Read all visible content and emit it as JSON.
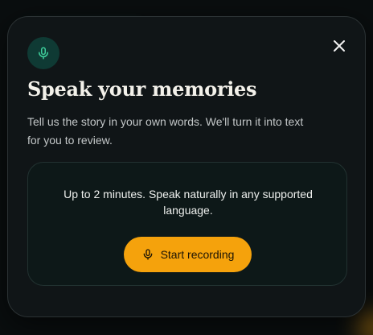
{
  "dialog": {
    "title": "Speak your memories",
    "subtitle": "Tell us the story in your own words. We'll turn it into text for you to review.",
    "hint": "Up to 2 minutes. Speak naturally in any supported language.",
    "record_button_label": "Start recording"
  },
  "icons": {
    "header": "microphone-icon",
    "close": "close-icon",
    "record": "microphone-icon"
  },
  "colors": {
    "accent": "#f5a20c",
    "mic_badge_bg": "#0f3a34",
    "mic_badge_icon": "#3ecf9c",
    "dialog_bg": "#101517",
    "panel_bg": "#0d1818"
  }
}
